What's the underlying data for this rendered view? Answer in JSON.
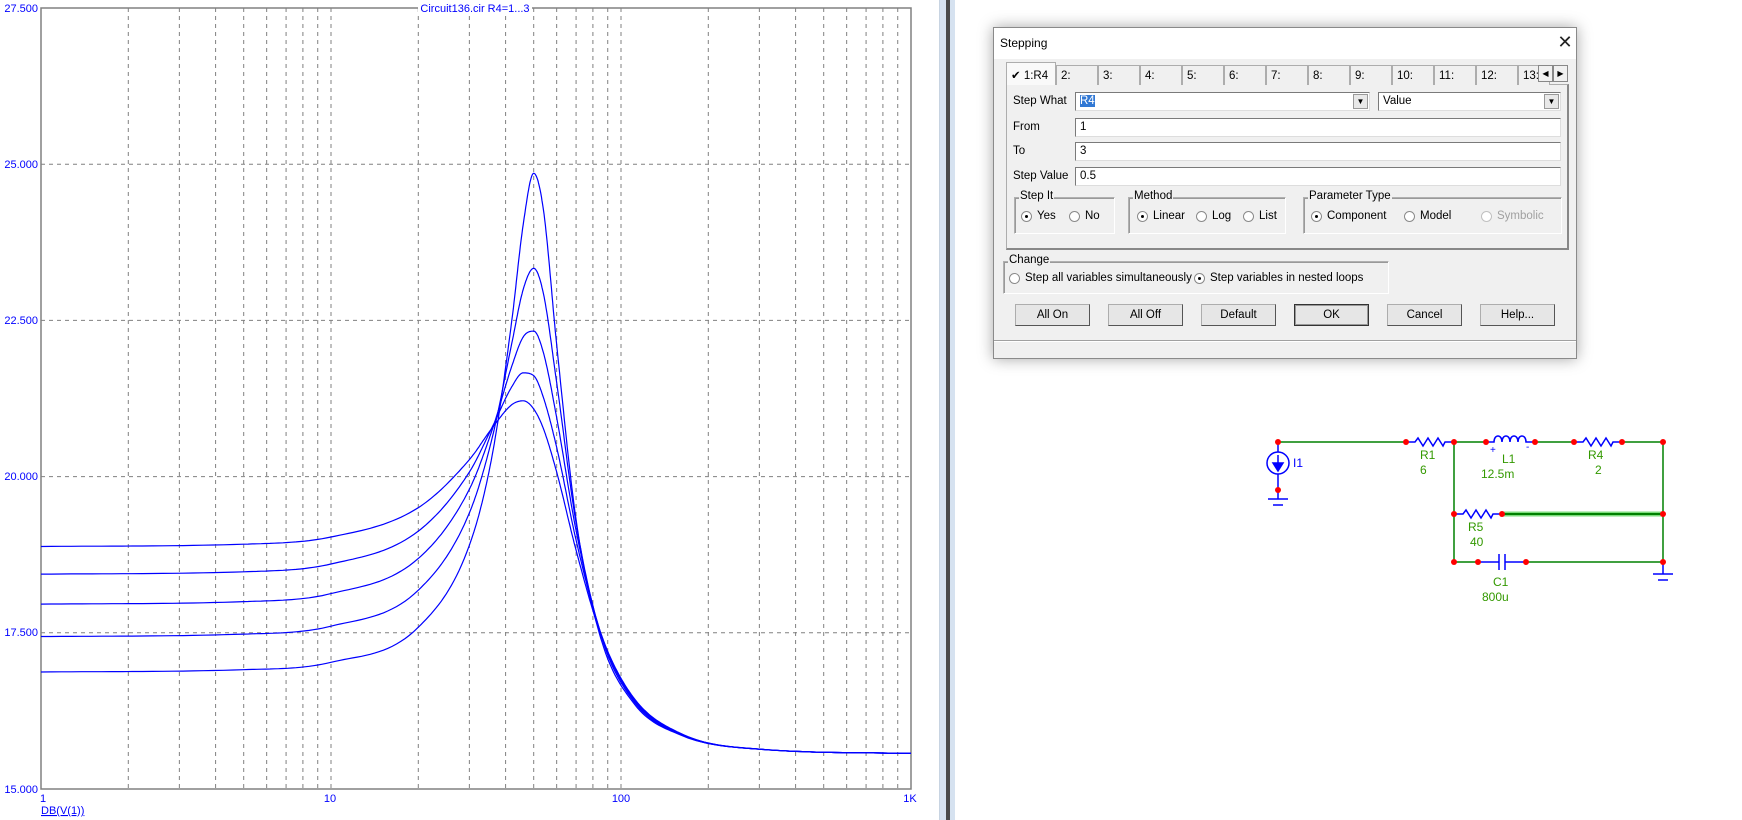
{
  "chart": {
    "title": "Circuit136.cir R4=1...3",
    "y_ticks": [
      "27.500",
      "25.000",
      "22.500",
      "20.000",
      "17.500",
      "15.000"
    ],
    "x_ticks": [
      "1",
      "10",
      "100",
      "1K"
    ],
    "trace_label": "DB(V(1))"
  },
  "chart_data": {
    "type": "line",
    "x_scale": "log",
    "xlim": [
      1,
      1000
    ],
    "ylim": [
      15,
      27.5
    ],
    "grid": true,
    "xlabel": "",
    "ylabel": "",
    "trace": "DB(V(1))",
    "line_color": "#0000ff",
    "x": [
      1,
      5,
      10,
      20,
      30,
      36,
      42,
      46,
      50,
      54,
      60,
      70,
      85,
      110,
      160,
      300,
      1000
    ],
    "series": [
      {
        "values": [
          16.873,
          16.91,
          17.028,
          17.589,
          18.902,
          20.354,
          22.488,
          24.034,
          24.854,
          24.274,
          22.113,
          19.31,
          17.427,
          16.387,
          15.867,
          15.637,
          15.569
        ]
      },
      {
        "values": [
          17.44,
          17.479,
          17.606,
          18.182,
          19.419,
          20.629,
          22.128,
          22.996,
          23.333,
          22.931,
          21.505,
          19.258,
          17.481,
          16.417,
          15.875,
          15.637,
          15.569
        ]
      },
      {
        "values": [
          17.959,
          17.999,
          18.127,
          18.69,
          19.798,
          20.756,
          21.765,
          22.235,
          22.328,
          21.984,
          20.945,
          19.137,
          17.505,
          16.442,
          15.882,
          15.637,
          15.569
        ]
      },
      {
        "values": [
          18.439,
          18.477,
          18.601,
          19.127,
          20.073,
          20.795,
          21.437,
          21.66,
          21.615,
          21.267,
          20.468,
          18.984,
          17.506,
          16.461,
          15.887,
          15.638,
          15.569
        ]
      },
      {
        "values": [
          18.882,
          18.918,
          19.033,
          19.503,
          20.272,
          20.782,
          21.15,
          21.213,
          21.082,
          20.768,
          20.073,
          18.822,
          17.489,
          16.474,
          15.893,
          15.638,
          15.569
        ]
      }
    ]
  },
  "dialog": {
    "title": "Stepping",
    "tabs": [
      "1:R4",
      "2:",
      "3:",
      "4:",
      "5:",
      "6:",
      "7:",
      "8:",
      "9:",
      "10:",
      "11:",
      "12:",
      "13:"
    ],
    "active_tab": "1:R4",
    "step_what_label": "Step What",
    "step_what_value": "R4",
    "step_type_value": "Value",
    "from_label": "From",
    "from_value": "1",
    "to_label": "To",
    "to_value": "3",
    "step_value_label": "Step Value",
    "step_value_value": "0.5",
    "step_it": {
      "title": "Step It",
      "yes": "Yes",
      "no": "No",
      "selected": "Yes"
    },
    "method": {
      "title": "Method",
      "linear": "Linear",
      "log": "Log",
      "list": "List",
      "selected": "Linear"
    },
    "param_type": {
      "title": "Parameter Type",
      "component": "Component",
      "model": "Model",
      "symbolic": "Symbolic",
      "selected": "Component"
    },
    "change": {
      "title": "Change",
      "simultaneous": "Step all variables simultaneously",
      "nested": "Step variables in nested loops",
      "selected": "nested"
    },
    "buttons": {
      "all_on": "All On",
      "all_off": "All Off",
      "default": "Default",
      "ok": "OK",
      "cancel": "Cancel",
      "help": "Help..."
    }
  },
  "schematic": {
    "I1": "I1",
    "R1": {
      "name": "R1",
      "value": "6"
    },
    "L1": {
      "name": "L1",
      "value": "12.5m"
    },
    "R4": {
      "name": "R4",
      "value": "2"
    },
    "R5": {
      "name": "R5",
      "value": "40"
    },
    "C1": {
      "name": "C1",
      "value": "800u"
    },
    "plus": "+",
    "minus": "-"
  },
  "colors": {
    "trace": "#0000ff",
    "wire": "#008000",
    "component": "#0000ff",
    "node": "#ff0000",
    "label": "#339900",
    "selection": "#3178d4"
  }
}
